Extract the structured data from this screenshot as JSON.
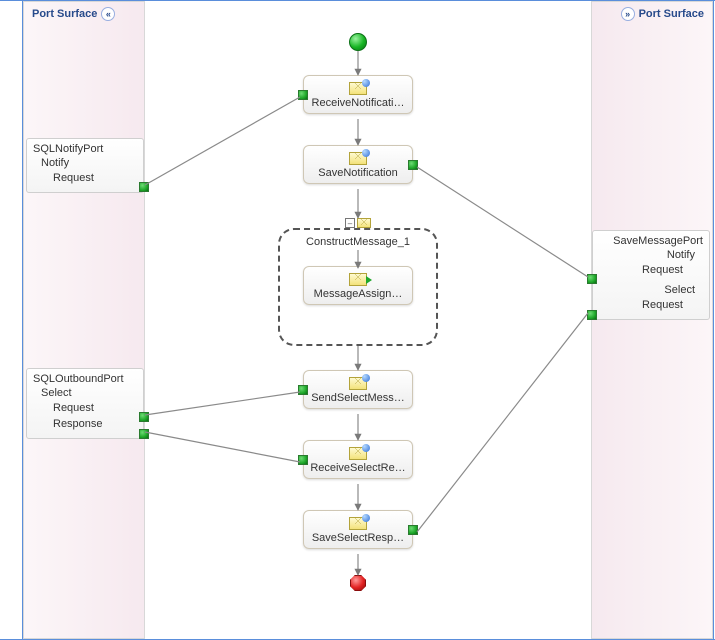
{
  "portSurface": {
    "labelLeft": "Port Surface",
    "labelRight": "Port Surface"
  },
  "leftPorts": {
    "sqlNotify": {
      "title": "SQLNotifyPort",
      "op": "Notify",
      "msg1": "Request"
    },
    "sqlOutbound": {
      "title": "SQLOutboundPort",
      "op": "Select",
      "msg1": "Request",
      "msg2": "Response"
    }
  },
  "rightPorts": {
    "saveMessage": {
      "title": "SaveMessagePort",
      "op1": "Notify",
      "msg1": "Request",
      "op2": "Select",
      "msg2": "Request"
    }
  },
  "shapes": {
    "start": "start",
    "receiveNotification": "ReceiveNotificati…",
    "saveNotification": "SaveNotification",
    "constructMessage": "ConstructMessage_1",
    "messageAssign": "MessageAssign…",
    "sendSelect": "SendSelectMess…",
    "receiveSelect": "ReceiveSelectRe…",
    "saveSelectResp": "SaveSelectResp…",
    "end": "end"
  }
}
